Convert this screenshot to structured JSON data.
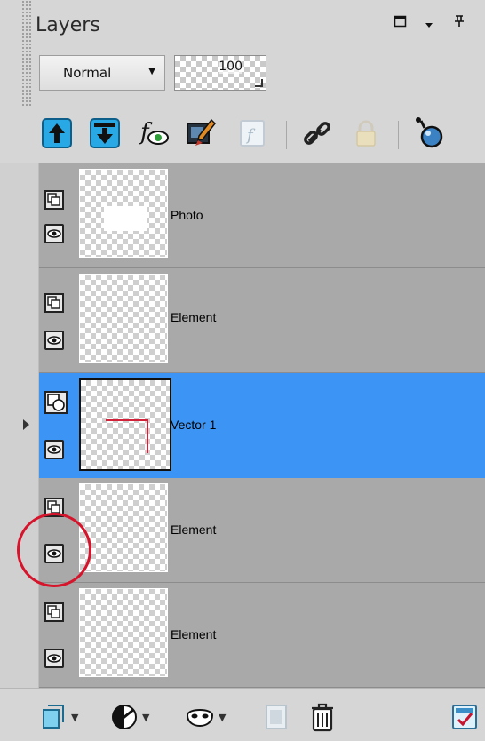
{
  "panel": {
    "title": "Layers",
    "title_icons": [
      "window-icon",
      "dropdown-icon",
      "pin-icon"
    ]
  },
  "properties": {
    "blend_mode": "Normal",
    "opacity": "100"
  },
  "toolbar": {
    "icons": [
      "move-up-icon",
      "move-down-icon",
      "layer-effects-icon",
      "edit-selection-icon",
      "script-icon",
      "link-icon",
      "lock-icon",
      "mask-icon"
    ]
  },
  "layers": [
    {
      "name": "Photo",
      "selected": false,
      "type_icon": "raster-layer-icon"
    },
    {
      "name": "Element",
      "selected": false,
      "type_icon": "raster-layer-icon"
    },
    {
      "name": "Vector 1",
      "selected": true,
      "type_icon": "vector-layer-icon"
    },
    {
      "name": "Element",
      "selected": false,
      "type_icon": "raster-layer-icon"
    },
    {
      "name": "Element",
      "selected": false,
      "type_icon": "raster-layer-icon"
    }
  ],
  "bottom_toolbar": {
    "icons": [
      "new-layer-icon",
      "adjustment-icon",
      "mask-icon",
      "group-icon",
      "delete-icon",
      "properties-icon"
    ]
  },
  "colors": {
    "selected": "#3c94f4",
    "highlight_circle": "#d6142b",
    "panel_bg": "#d6d6d6",
    "list_bg": "#a9a9a9"
  }
}
